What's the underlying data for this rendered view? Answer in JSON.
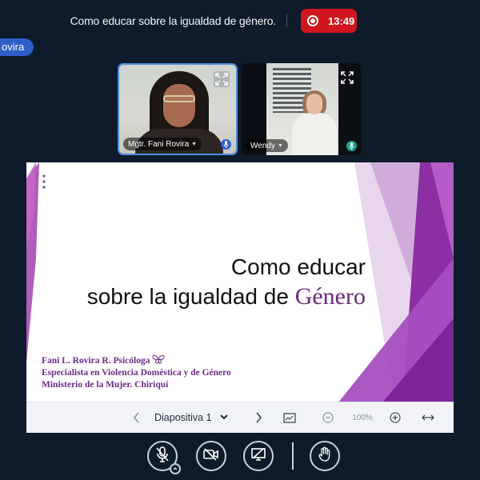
{
  "meeting": {
    "title": "Como educar sobre la igualdad de género.",
    "recording_time": "13:49",
    "presenter_badge": "ovira"
  },
  "colors": {
    "record": "#d0161e",
    "presenter": "#2e5fc9",
    "active_speaker_border": "#4a90e2",
    "slide_accent": "#6a2a7a"
  },
  "participants": [
    {
      "name": "Mgtr. Fani Rovira",
      "mic_icon": "mic-icon",
      "expand_icon": "expand-icon"
    },
    {
      "name": "Wendy",
      "mic_icon": "mic-icon",
      "expand_icon": "expand-icon"
    }
  ],
  "slide": {
    "title_line1": "Como educar",
    "title_line2_prefix": "sobre la igualdad de ",
    "title_line2_accent": "Género",
    "credits": [
      "Fani L. Rovira R. Psicóloga",
      "Especialista en Violencia Doméstica y de Género",
      "Ministerio de la Mujer. Chiriquí"
    ]
  },
  "slide_toolbar": {
    "prev_icon": "chevron-left-icon",
    "current_slide": "Diapositiva 1",
    "next_icon": "chevron-right-icon",
    "whiteboard_icon": "whiteboard-icon",
    "zoom_out_icon": "zoom-out-icon",
    "zoom_level": "100%",
    "zoom_in_icon": "zoom-in-icon",
    "fit_icon": "fit-width-icon"
  },
  "controls": {
    "mic": "mic-muted-icon",
    "camera": "camera-off-icon",
    "screen_share": "screen-share-off-icon",
    "raise_hand": "raise-hand-icon"
  }
}
